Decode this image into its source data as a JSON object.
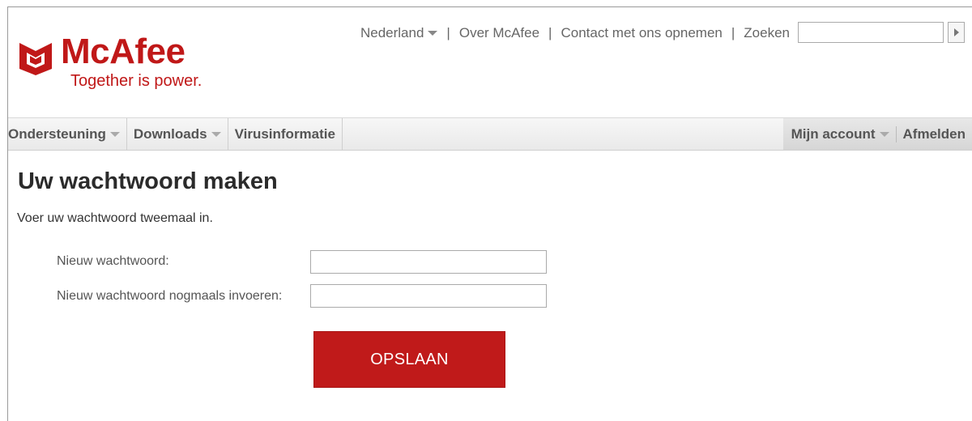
{
  "brand": {
    "name": "McAfee",
    "tagline": "Together is power.",
    "accent_color": "#c01818"
  },
  "utility_nav": {
    "country": "Nederland",
    "about": "Over McAfee",
    "contact": "Contact met ons opnemen",
    "search_label": "Zoeken",
    "search_value": "",
    "separator": "|"
  },
  "main_nav": {
    "items": [
      {
        "label": "Ondersteuning",
        "dropdown": true
      },
      {
        "label": "Downloads",
        "dropdown": true
      },
      {
        "label": "Virusinformatie",
        "dropdown": false
      }
    ],
    "account_label": "Mijn account",
    "logout_label": "Afmelden"
  },
  "form": {
    "title": "Uw wachtwoord maken",
    "instruction": "Voer uw wachtwoord tweemaal in.",
    "new_password_label": "Nieuw wachtwoord:",
    "new_password_value": "",
    "confirm_password_label": "Nieuw wachtwoord nogmaals invoeren:",
    "confirm_password_value": "",
    "save_label": "OPSLAAN",
    "save_color": "#c01a1a"
  }
}
